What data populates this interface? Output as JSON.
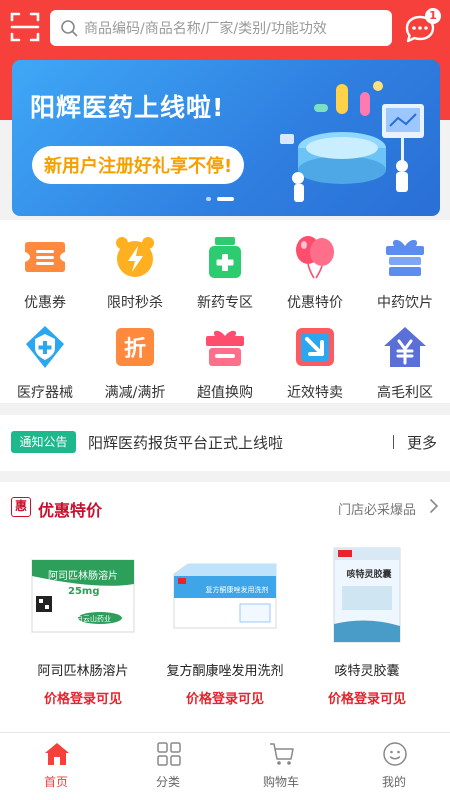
{
  "header": {
    "search_placeholder": "商品编码/商品名称/厂家/类别/功能功效",
    "message_badge": "1",
    "accent_color": "#f5403b",
    "icons": [
      "scan-icon",
      "search-icon",
      "message-icon"
    ]
  },
  "banner": {
    "title": "阳辉医药上线啦!",
    "subtitle": "新用户注册好礼享不停!"
  },
  "categories": [
    {
      "label": "优惠券",
      "icon": "coupon-icon"
    },
    {
      "label": "限时秒杀",
      "icon": "alarm-clock-icon"
    },
    {
      "label": "新药专区",
      "icon": "medicine-bottle-icon"
    },
    {
      "label": "优惠特价",
      "icon": "balloons-icon"
    },
    {
      "label": "中药饮片",
      "icon": "gift-box-icon"
    },
    {
      "label": "医疗器械",
      "icon": "medical-shield-icon"
    },
    {
      "label": "满减/满折",
      "icon": "discount-tag-icon"
    },
    {
      "label": "超值换购",
      "icon": "gift-icon"
    },
    {
      "label": "近效特卖",
      "icon": "arrow-box-icon"
    },
    {
      "label": "高毛利区",
      "icon": "yuan-house-icon"
    }
  ],
  "notice": {
    "tag": "通知公告",
    "text": "阳辉医药报货平台正式上线啦",
    "more": "更多"
  },
  "deals": {
    "badge": "惠",
    "title": "优惠特价",
    "subtitle": "门店必采爆品",
    "products": [
      {
        "name": "阿司匹林肠溶片",
        "price": "价格登录可见",
        "box_text": "阿司匹林肠溶片",
        "box_dose": "25mg",
        "box_brand": "白云山药业"
      },
      {
        "name": "复方酮康唑发用洗剂",
        "price": "价格登录可见",
        "box_text": "复方酮康唑发用洗剂"
      },
      {
        "name": "咳特灵胶囊",
        "price": "价格登录可见",
        "box_text": "咳特灵胶囊"
      }
    ]
  },
  "tabbar": {
    "items": [
      {
        "label": "首页",
        "icon": "home-icon",
        "active": true
      },
      {
        "label": "分类",
        "icon": "grid-icon",
        "active": false
      },
      {
        "label": "购物车",
        "icon": "cart-icon",
        "active": false
      },
      {
        "label": "我的",
        "icon": "user-icon",
        "active": false
      }
    ]
  }
}
